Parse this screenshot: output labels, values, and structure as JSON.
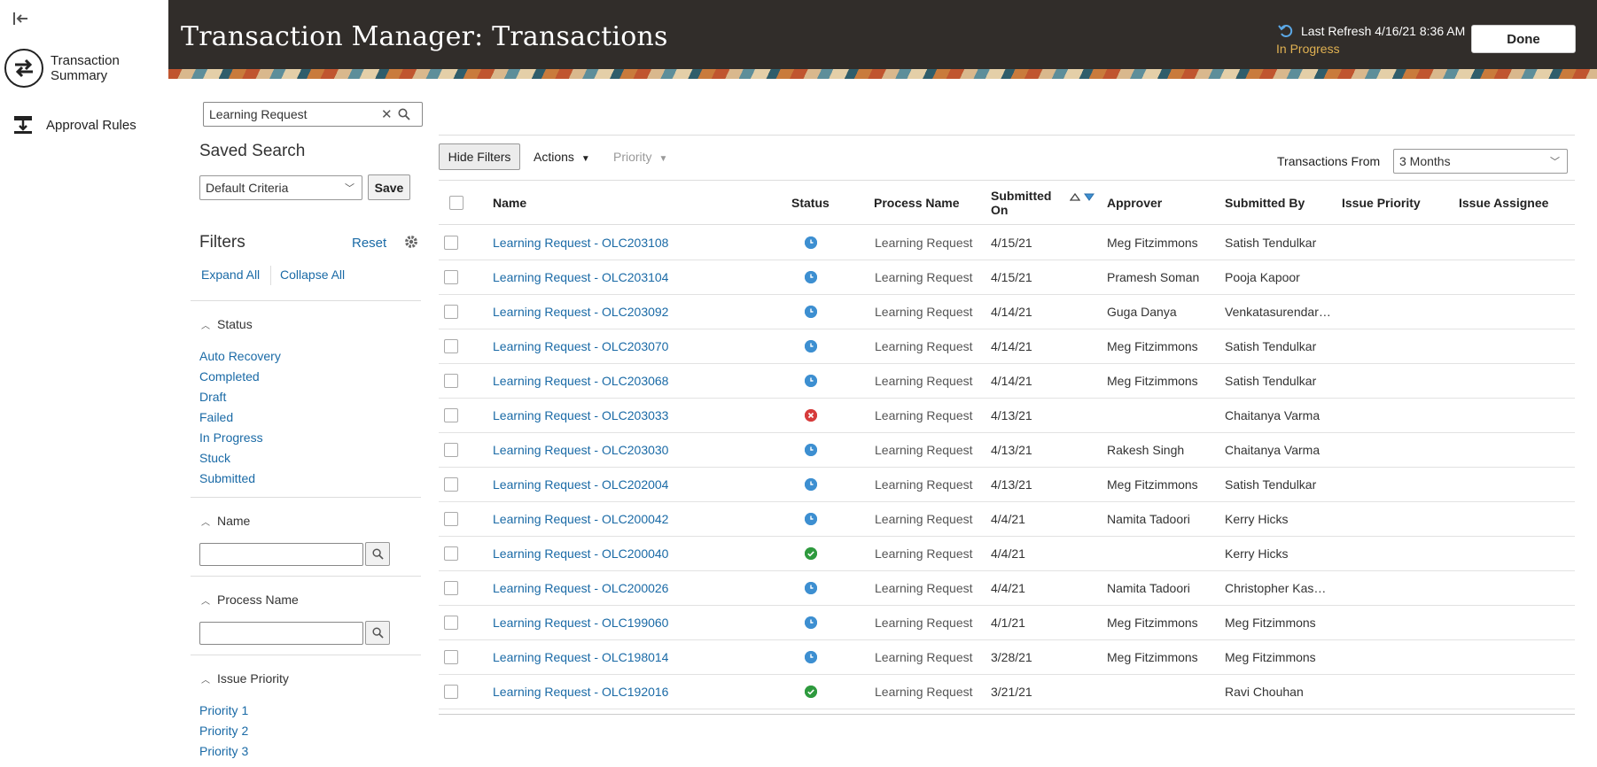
{
  "nav": {
    "items": [
      {
        "label": "Transaction Summary",
        "icon": "swap-arrows-icon"
      },
      {
        "label": "Approval Rules",
        "icon": "approval-rules-icon"
      }
    ]
  },
  "header": {
    "title": "Transaction Manager: Transactions",
    "last_refresh": "Last Refresh 4/16/21 8:36 AM",
    "refresh_status": "In Progress",
    "done_label": "Done"
  },
  "search": {
    "value": "Learning Request"
  },
  "saved_search": {
    "title": "Saved Search",
    "selected": "Default Criteria",
    "save_label": "Save"
  },
  "filters": {
    "title": "Filters",
    "reset_label": "Reset",
    "expand_all": "Expand All",
    "collapse_all": "Collapse All",
    "status_section": {
      "title": "Status",
      "options": [
        "Auto Recovery",
        "Completed",
        "Draft",
        "Failed",
        "In Progress",
        "Stuck",
        "Submitted"
      ]
    },
    "name_section": {
      "title": "Name"
    },
    "process_section": {
      "title": "Process Name"
    },
    "priority_section": {
      "title": "Issue Priority",
      "options": [
        "Priority 1",
        "Priority 2",
        "Priority 3"
      ]
    }
  },
  "toolbar": {
    "hide_filters": "Hide Filters",
    "actions": "Actions",
    "priority": "Priority",
    "transactions_from_label": "Transactions From",
    "transactions_from_value": "3 Months"
  },
  "table": {
    "columns": {
      "name": "Name",
      "status": "Status",
      "process": "Process Name",
      "submitted_on": "Submitted On",
      "approver": "Approver",
      "submitted_by": "Submitted By",
      "issue_priority": "Issue Priority",
      "issue_assignee": "Issue Assignee"
    },
    "status_colors": {
      "in_progress": "#3d8fd1",
      "failed": "#d63b3b",
      "completed": "#2e9a3e"
    },
    "rows": [
      {
        "name": "Learning Request - OLC203108",
        "status": "in_progress",
        "process": "Learning Request",
        "submitted_on": "4/15/21",
        "approver": "Meg Fitzimmons",
        "submitted_by": "Satish Tendulkar"
      },
      {
        "name": "Learning Request - OLC203104",
        "status": "in_progress",
        "process": "Learning Request",
        "submitted_on": "4/15/21",
        "approver": "Pramesh Soman",
        "submitted_by": "Pooja Kapoor"
      },
      {
        "name": "Learning Request - OLC203092",
        "status": "in_progress",
        "process": "Learning Request",
        "submitted_on": "4/14/21",
        "approver": "Guga Danya",
        "submitted_by": "Venkatasurendar…"
      },
      {
        "name": "Learning Request - OLC203070",
        "status": "in_progress",
        "process": "Learning Request",
        "submitted_on": "4/14/21",
        "approver": "Meg Fitzimmons",
        "submitted_by": "Satish Tendulkar"
      },
      {
        "name": "Learning Request - OLC203068",
        "status": "in_progress",
        "process": "Learning Request",
        "submitted_on": "4/14/21",
        "approver": "Meg Fitzimmons",
        "submitted_by": "Satish Tendulkar"
      },
      {
        "name": "Learning Request - OLC203033",
        "status": "failed",
        "process": "Learning Request",
        "submitted_on": "4/13/21",
        "approver": "",
        "submitted_by": "Chaitanya Varma"
      },
      {
        "name": "Learning Request - OLC203030",
        "status": "in_progress",
        "process": "Learning Request",
        "submitted_on": "4/13/21",
        "approver": "Rakesh Singh",
        "submitted_by": "Chaitanya Varma"
      },
      {
        "name": "Learning Request - OLC202004",
        "status": "in_progress",
        "process": "Learning Request",
        "submitted_on": "4/13/21",
        "approver": "Meg Fitzimmons",
        "submitted_by": "Satish Tendulkar"
      },
      {
        "name": "Learning Request - OLC200042",
        "status": "in_progress",
        "process": "Learning Request",
        "submitted_on": "4/4/21",
        "approver": "Namita Tadoori",
        "submitted_by": "Kerry Hicks"
      },
      {
        "name": "Learning Request - OLC200040",
        "status": "completed",
        "process": "Learning Request",
        "submitted_on": "4/4/21",
        "approver": "",
        "submitted_by": "Kerry Hicks"
      },
      {
        "name": "Learning Request - OLC200026",
        "status": "in_progress",
        "process": "Learning Request",
        "submitted_on": "4/4/21",
        "approver": "Namita Tadoori",
        "submitted_by": "Christopher Kas…"
      },
      {
        "name": "Learning Request - OLC199060",
        "status": "in_progress",
        "process": "Learning Request",
        "submitted_on": "4/1/21",
        "approver": "Meg Fitzimmons",
        "submitted_by": "Meg Fitzimmons"
      },
      {
        "name": "Learning Request - OLC198014",
        "status": "in_progress",
        "process": "Learning Request",
        "submitted_on": "3/28/21",
        "approver": "Meg Fitzimmons",
        "submitted_by": "Meg Fitzimmons"
      },
      {
        "name": "Learning Request - OLC192016",
        "status": "completed",
        "process": "Learning Request",
        "submitted_on": "3/21/21",
        "approver": "",
        "submitted_by": "Ravi Chouhan"
      }
    ]
  }
}
